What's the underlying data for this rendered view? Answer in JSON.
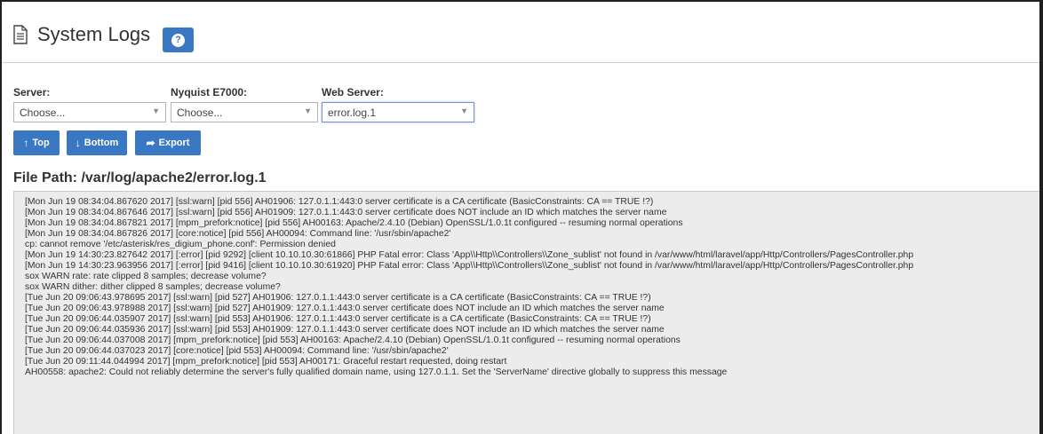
{
  "header": {
    "title": "System Logs",
    "help_label": "?"
  },
  "filters": {
    "server": {
      "label": "Server:",
      "value": "Choose..."
    },
    "nyquist": {
      "label": "Nyquist E7000:",
      "value": "Choose..."
    },
    "webserver": {
      "label": "Web Server:",
      "value": "error.log.1"
    }
  },
  "toolbar": {
    "top_label": "Top",
    "bottom_label": "Bottom",
    "export_label": "Export"
  },
  "file_path": "File Path: /var/log/apache2/error.log.1",
  "log_lines": [
    "[Mon Jun 19 08:34:04.867620 2017] [ssl:warn] [pid 556] AH01906: 127.0.1.1:443:0 server certificate is a CA certificate (BasicConstraints: CA == TRUE !?)",
    "[Mon Jun 19 08:34:04.867646 2017] [ssl:warn] [pid 556] AH01909: 127.0.1.1:443:0 server certificate does NOT include an ID which matches the server name",
    "[Mon Jun 19 08:34:04.867821 2017] [mpm_prefork:notice] [pid 556] AH00163: Apache/2.4.10 (Debian) OpenSSL/1.0.1t configured -- resuming normal operations",
    "[Mon Jun 19 08:34:04.867826 2017] [core:notice] [pid 556] AH00094: Command line: '/usr/sbin/apache2'",
    "cp: cannot remove '/etc/asterisk/res_digium_phone.conf': Permission denied",
    "[Mon Jun 19 14:30:23.827642 2017] [:error] [pid 9292] [client 10.10.10.30:61866] PHP Fatal error:  Class 'App\\\\Http\\\\Controllers\\\\Zone_sublist' not found in /var/www/html/laravel/app/Http/Controllers/PagesController.php",
    "[Mon Jun 19 14:30:23.963956 2017] [:error] [pid 9416] [client 10.10.10.30:61920] PHP Fatal error:  Class 'App\\\\Http\\\\Controllers\\\\Zone_sublist' not found in /var/www/html/laravel/app/Http/Controllers/PagesController.php",
    "sox WARN rate: rate clipped 8 samples; decrease volume?",
    "sox WARN dither: dither clipped 8 samples; decrease volume?",
    "[Tue Jun 20 09:06:43.978695 2017] [ssl:warn] [pid 527] AH01906: 127.0.1.1:443:0 server certificate is a CA certificate (BasicConstraints: CA == TRUE !?)",
    "[Tue Jun 20 09:06:43.978988 2017] [ssl:warn] [pid 527] AH01909: 127.0.1.1:443:0 server certificate does NOT include an ID which matches the server name",
    "[Tue Jun 20 09:06:44.035907 2017] [ssl:warn] [pid 553] AH01906: 127.0.1.1:443:0 server certificate is a CA certificate (BasicConstraints: CA == TRUE !?)",
    "[Tue Jun 20 09:06:44.035936 2017] [ssl:warn] [pid 553] AH01909: 127.0.1.1:443:0 server certificate does NOT include an ID which matches the server name",
    "[Tue Jun 20 09:06:44.037008 2017] [mpm_prefork:notice] [pid 553] AH00163: Apache/2.4.10 (Debian) OpenSSL/1.0.1t configured -- resuming normal operations",
    "[Tue Jun 20 09:06:44.037023 2017] [core:notice] [pid 553] AH00094: Command line: '/usr/sbin/apache2'",
    "[Tue Jun 20 09:11:44.044994 2017] [mpm_prefork:notice] [pid 553] AH00171: Graceful restart requested, doing restart",
    "AH00558: apache2: Could not reliably determine the server's fully qualified domain name, using 127.0.1.1. Set the 'ServerName' directive globally to suppress this message"
  ]
}
